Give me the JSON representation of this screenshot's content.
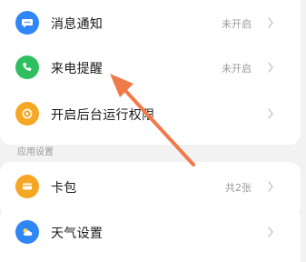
{
  "settings": {
    "items": [
      {
        "label": "消息通知",
        "status": "未开启",
        "icon": "message-icon",
        "color": "#2f86f6"
      },
      {
        "label": "来电提醒",
        "status": "未开启",
        "icon": "phone-icon",
        "color": "#2fbf5f"
      },
      {
        "label": "开启后台运行权限",
        "status": "",
        "icon": "background-run-icon",
        "color": "#f5a623"
      }
    ],
    "section_title": "应用设置",
    "app_items": [
      {
        "label": "卡包",
        "status": "共2张",
        "icon": "card-wallet-icon",
        "color": "#f5a623"
      },
      {
        "label": "天气设置",
        "status": "",
        "icon": "weather-icon",
        "color": "#2f86f6"
      }
    ]
  },
  "annotation": {
    "arrow_color": "#f07a4a"
  }
}
